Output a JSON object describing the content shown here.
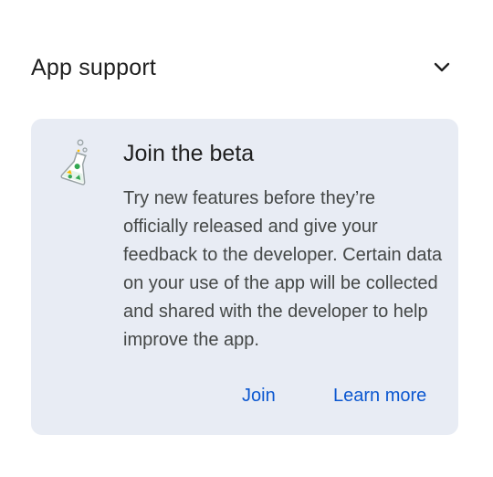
{
  "section": {
    "title": "App support",
    "toggle_icon": "chevron-down-icon"
  },
  "beta_card": {
    "icon": "flask-icon",
    "title": "Join the beta",
    "body": "Try new features before they’re officially released and give your feedback to the developer. Certain data on your use of the app will be collected and shared with the developer to help improve the app.",
    "join_label": "Join",
    "learn_more_label": "Learn more"
  },
  "colors": {
    "card_background": "#e8ecf4",
    "accent": "#0b57d0",
    "title_text": "#1f1f1f",
    "body_text": "#444746"
  }
}
